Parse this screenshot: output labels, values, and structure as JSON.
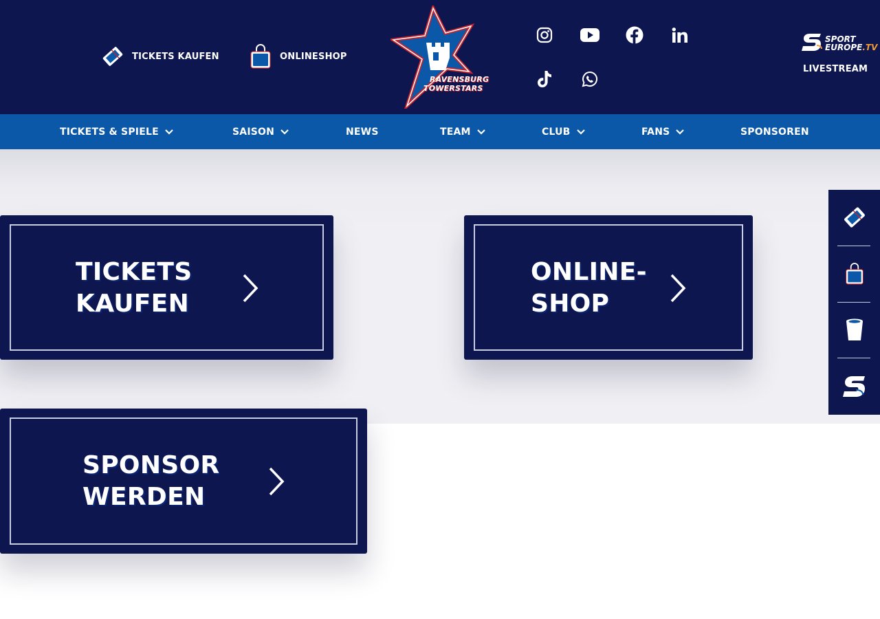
{
  "header": {
    "top_links": [
      {
        "label": "TICKETS KAUFEN",
        "icon": "ticket-icon"
      },
      {
        "label": "ONLINESHOP",
        "icon": "shopping-bag-icon"
      }
    ],
    "logo": {
      "line1": "RAVENSBURG",
      "line2": "TOWERSTARS",
      "colors": {
        "star_fill": "#0b58a8",
        "star_outline": "#c8232c"
      }
    },
    "social_icons": [
      "instagram-icon",
      "youtube-icon",
      "facebook-icon",
      "linkedin-icon",
      "tiktok-icon",
      "whatsapp-icon"
    ],
    "livestream": {
      "brand_line1": "SPORT",
      "brand_line2": "EUROPE",
      "brand_suffix": ".TV",
      "label": "LIVESTREAM"
    }
  },
  "nav": {
    "items": [
      {
        "label": "TICKETS & SPIELE",
        "has_dropdown": true
      },
      {
        "label": "SAISON",
        "has_dropdown": true
      },
      {
        "label": "NEWS",
        "has_dropdown": false
      },
      {
        "label": "TEAM",
        "has_dropdown": true
      },
      {
        "label": "CLUB",
        "has_dropdown": true
      },
      {
        "label": "FANS",
        "has_dropdown": true
      },
      {
        "label": "SPONSOREN",
        "has_dropdown": false
      }
    ]
  },
  "cta": {
    "tickets": {
      "line1": "TICKETS",
      "line2": "KAUFEN"
    },
    "shop": {
      "line1": "ONLINE-",
      "line2": "SHOP"
    },
    "sponsor": {
      "line1": "SPONSOR",
      "line2": "WERDEN"
    }
  },
  "sidebar": {
    "icons": [
      "ticket-icon",
      "shopping-bag-icon",
      "cup-icon",
      "sporteurope-icon"
    ]
  },
  "colors": {
    "navy": "#0e1650",
    "nav_blue": "#0b58a8",
    "accent_red": "#c8232c",
    "accent_orange": "#f39c35"
  }
}
